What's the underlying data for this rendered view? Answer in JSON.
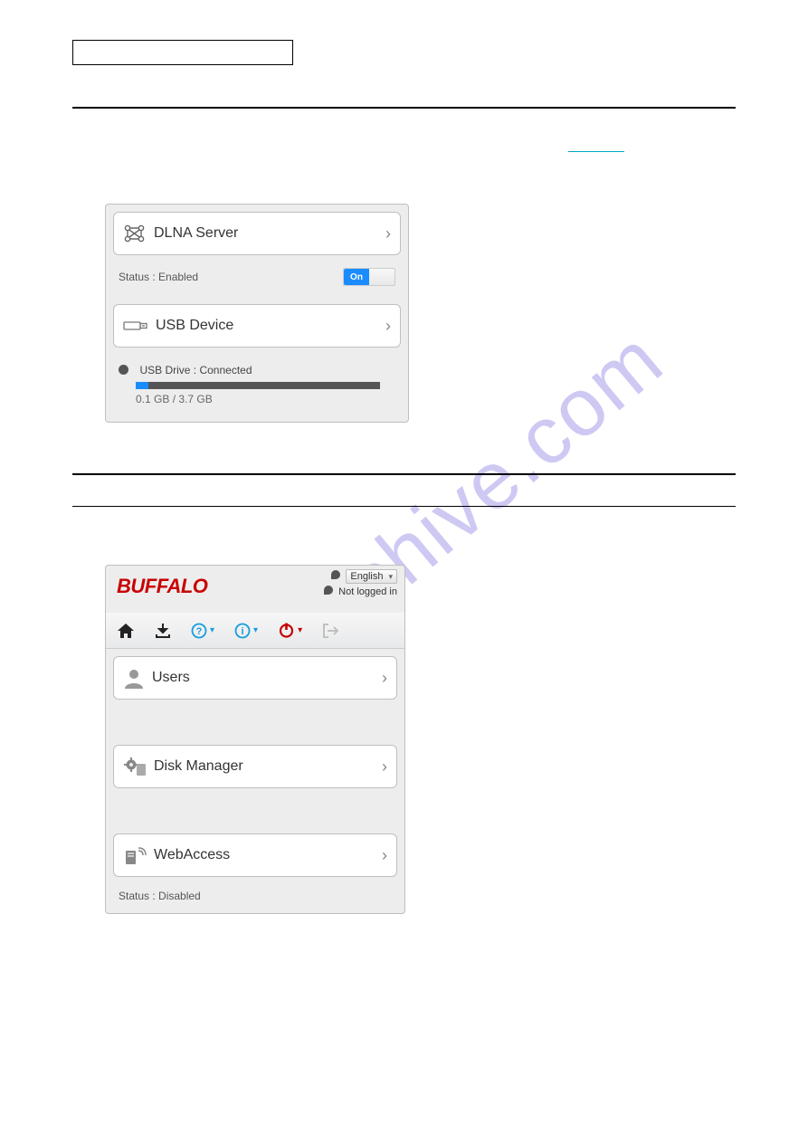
{
  "panel1": {
    "dlna": {
      "title": "DLNA Server",
      "status_label": "Status : Enabled",
      "toggle": "On"
    },
    "usb": {
      "title": "USB Device",
      "drive_label": "USB Drive : Connected",
      "size_label": "0.1 GB / 3.7 GB"
    }
  },
  "panel2": {
    "brand": "BUFFALO",
    "language": "English",
    "login_status": "Not logged in",
    "users": {
      "title": "Users"
    },
    "disk": {
      "title": "Disk Manager"
    },
    "web": {
      "title": "WebAccess",
      "status_label": "Status : Disabled"
    }
  }
}
